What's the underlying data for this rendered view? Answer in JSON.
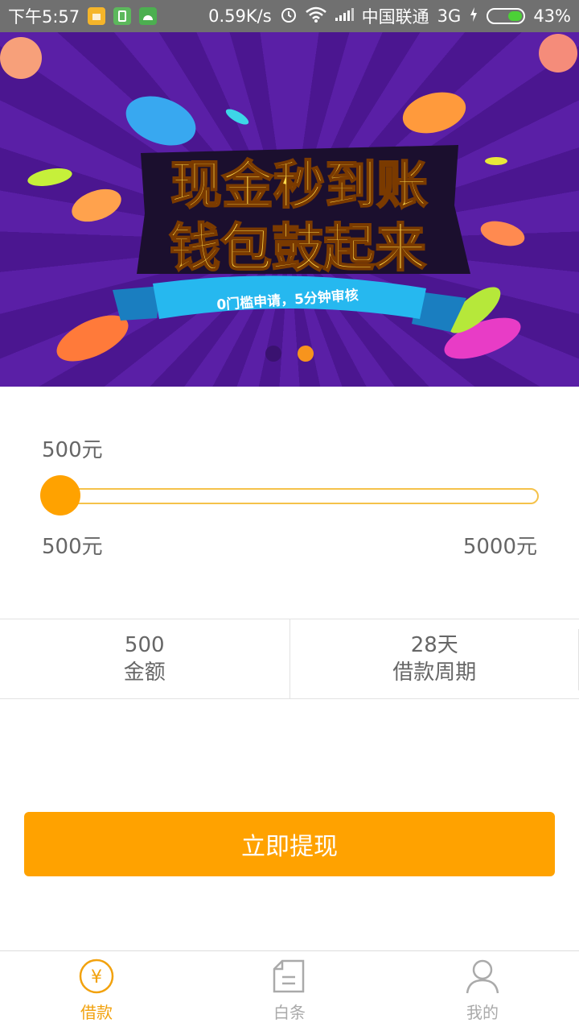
{
  "status_bar": {
    "time": "下午5:57",
    "speed": "0.59K/s",
    "carrier": "中国联通",
    "network": "3G",
    "battery": "43%",
    "battery_level": 0.43,
    "icons": [
      "app-yellow-icon",
      "app-green-icon",
      "android-icon",
      "alarm-icon",
      "wifi-icon",
      "signal-icon",
      "charging-icon"
    ]
  },
  "banner": {
    "headline_1": "现金秒到账",
    "headline_2": "钱包鼓起来",
    "ribbon": "0门槛申请，5分钟审核",
    "page_count": 2,
    "active_page": 2
  },
  "loan": {
    "current_amount": "500元",
    "min_label": "500元",
    "max_label": "5000元",
    "slider_fraction": 0
  },
  "info": {
    "amount_value": "500",
    "amount_label": "金额",
    "period_value": "28天",
    "period_label": "借款周期"
  },
  "cta": {
    "label": "立即提现"
  },
  "tabs": [
    {
      "label": "借款",
      "icon": "yen-circle-icon",
      "active": true
    },
    {
      "label": "白条",
      "icon": "document-icon",
      "active": false
    },
    {
      "label": "我的",
      "icon": "person-icon",
      "active": false
    }
  ],
  "colors": {
    "accent": "#ffa200",
    "tab_active": "#f2a20e",
    "banner_bg": "#5a1fa6"
  }
}
